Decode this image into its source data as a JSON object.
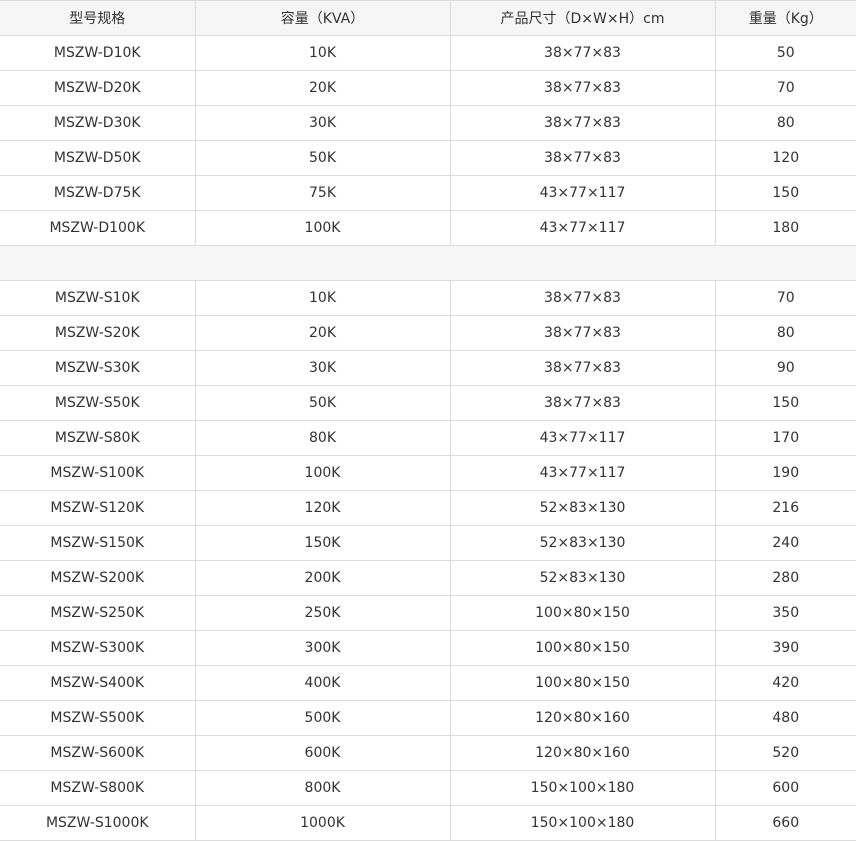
{
  "table": {
    "headers": [
      "型号规格",
      "容量（KVA）",
      "产品尺寸（D×W×H）cm",
      "重量（Kg）"
    ],
    "group_d": [
      [
        "MSZW-D10K",
        "10K",
        "38×77×83",
        "50"
      ],
      [
        "MSZW-D20K",
        "20K",
        "38×77×83",
        "70"
      ],
      [
        "MSZW-D30K",
        "30K",
        "38×77×83",
        "80"
      ],
      [
        "MSZW-D50K",
        "50K",
        "38×77×83",
        "120"
      ],
      [
        "MSZW-D75K",
        "75K",
        "43×77×117",
        "150"
      ],
      [
        "MSZW-D100K",
        "100K",
        "43×77×117",
        "180"
      ]
    ],
    "group_s": [
      [
        "MSZW-S10K",
        "10K",
        "38×77×83",
        "70"
      ],
      [
        "MSZW-S20K",
        "20K",
        "38×77×83",
        "80"
      ],
      [
        "MSZW-S30K",
        "30K",
        "38×77×83",
        "90"
      ],
      [
        "MSZW-S50K",
        "50K",
        "38×77×83",
        "150"
      ],
      [
        "MSZW-S80K",
        "80K",
        "43×77×117",
        "170"
      ],
      [
        "MSZW-S100K",
        "100K",
        "43×77×117",
        "190"
      ],
      [
        "MSZW-S120K",
        "120K",
        "52×83×130",
        "216"
      ],
      [
        "MSZW-S150K",
        "150K",
        "52×83×130",
        "240"
      ],
      [
        "MSZW-S200K",
        "200K",
        "52×83×130",
        "280"
      ],
      [
        "MSZW-S250K",
        "250K",
        "100×80×150",
        "350"
      ],
      [
        "MSZW-S300K",
        "300K",
        "100×80×150",
        "390"
      ],
      [
        "MSZW-S400K",
        "400K",
        "100×80×150",
        "420"
      ],
      [
        "MSZW-S500K",
        "500K",
        "120×80×160",
        "480"
      ],
      [
        "MSZW-S600K",
        "600K",
        "120×80×160",
        "520"
      ],
      [
        "MSZW-S800K",
        "800K",
        "150×100×180",
        "600"
      ],
      [
        "MSZW-S1000K",
        "1000K",
        "150×100×180",
        "660"
      ]
    ]
  }
}
